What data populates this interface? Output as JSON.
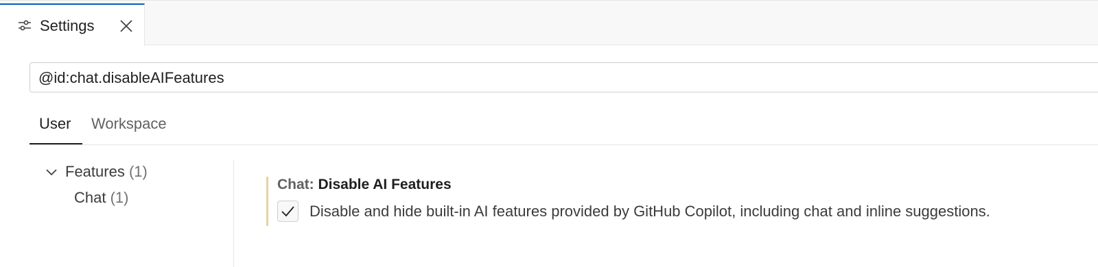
{
  "editor_tab": {
    "label": "Settings",
    "icon": "settings-sliders-icon",
    "close_icon": "close-icon",
    "accent_color": "#005fb8"
  },
  "search": {
    "value": "@id:chat.disableAIFeatures"
  },
  "scope_tabs": [
    {
      "label": "User",
      "active": true
    },
    {
      "label": "Workspace",
      "active": false
    }
  ],
  "toc": {
    "groups": [
      {
        "label": "Features",
        "count": "(1)",
        "expanded": true,
        "icon": "chevron-down-icon",
        "children": [
          {
            "label": "Chat",
            "count": "(1)"
          }
        ]
      }
    ]
  },
  "setting": {
    "category": "Chat: ",
    "name": "Disable AI Features",
    "checked": true,
    "description": "Disable and hide built-in AI features provided by GitHub Copilot, including chat and inline suggestions.",
    "modified_bar_color": "#e6d3a3"
  }
}
